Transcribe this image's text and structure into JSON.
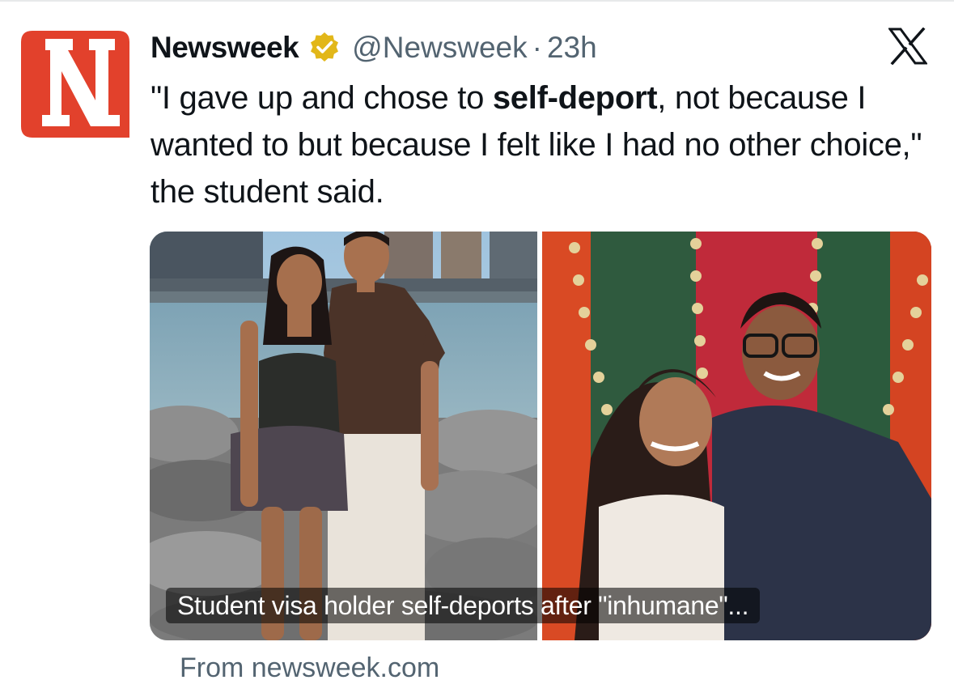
{
  "tweet": {
    "author_name": "Newsweek",
    "handle": "@Newsweek",
    "separator": "·",
    "time": "23h",
    "text_before": "\"I gave up and chose to ",
    "text_bold": "self-deport",
    "text_after": ", not because I wanted to but because I felt like I had no other choice,\" the student said."
  },
  "card": {
    "caption": "Student visa holder self-deports after \"inhumane\"...",
    "source": "From newsweek.com"
  },
  "icons": {
    "avatar": "newsweek-logo",
    "verified": "verified-badge-icon",
    "platform": "x-logo-icon"
  },
  "colors": {
    "brand_red": "#e2412c",
    "verified_gold": "#e2b719",
    "secondary_text": "#536471"
  }
}
